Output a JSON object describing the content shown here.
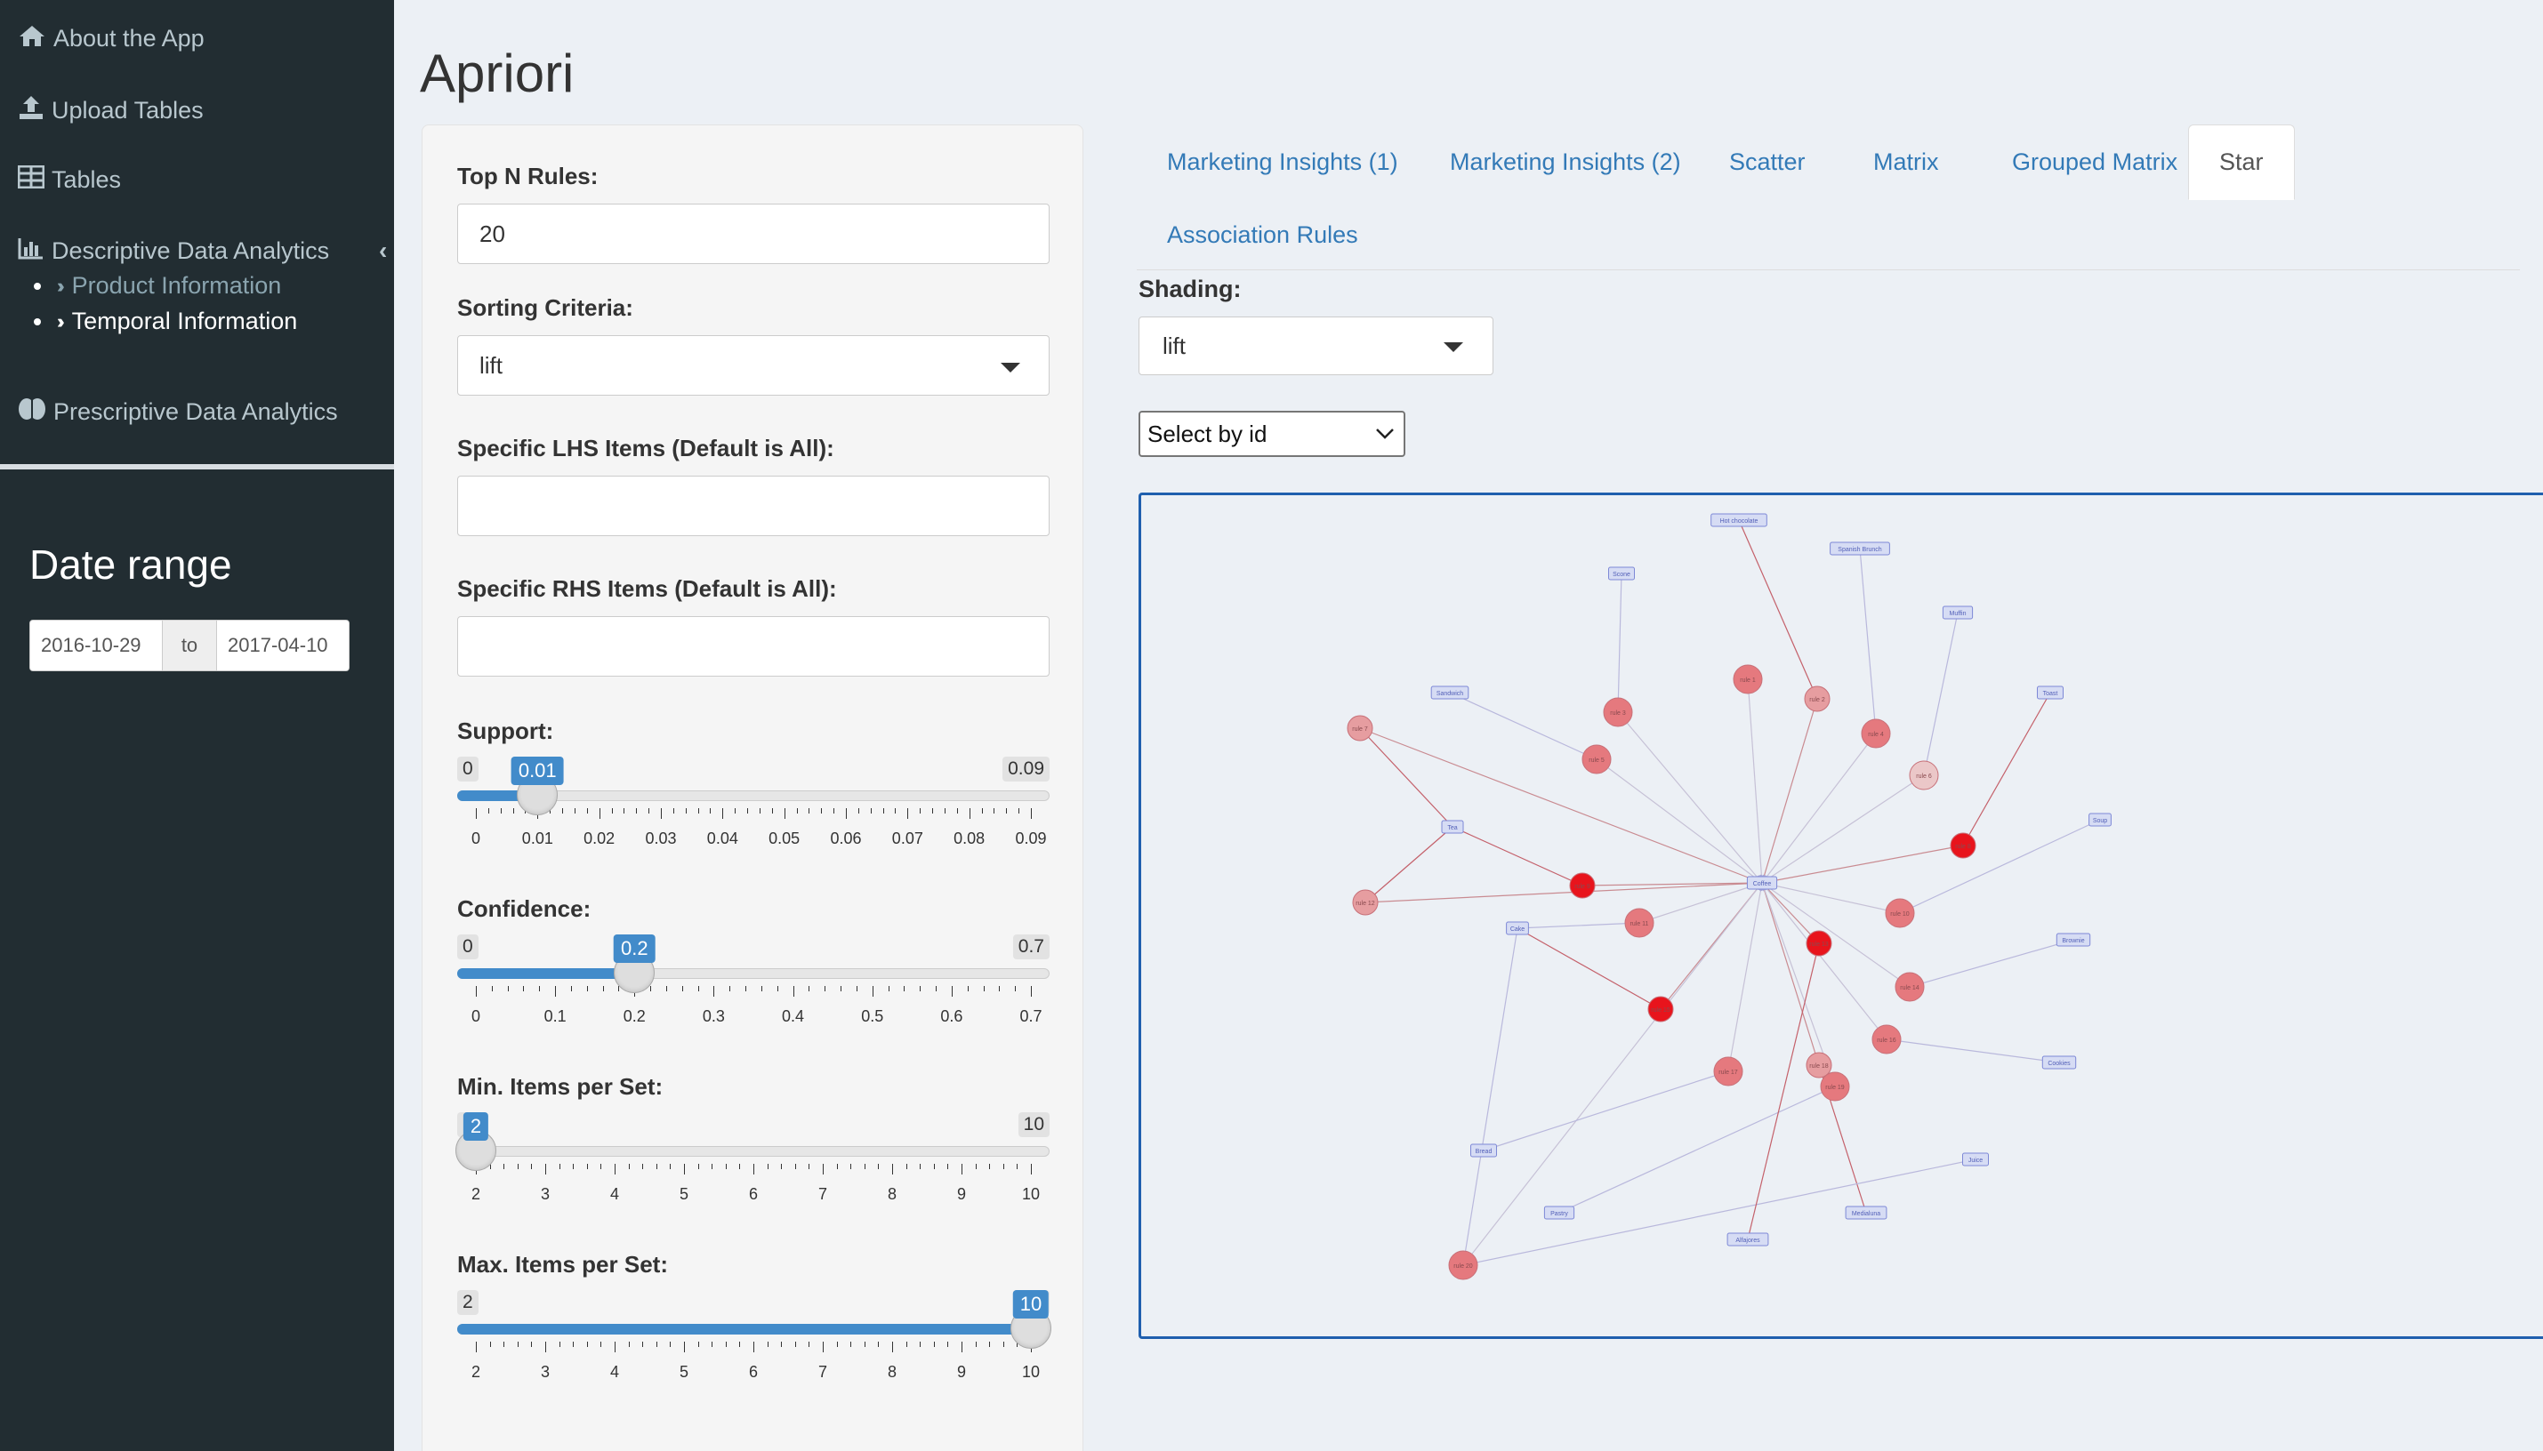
{
  "sidebar": {
    "items": [
      {
        "label": "About the App",
        "icon": "home-icon"
      },
      {
        "label": "Upload Tables",
        "icon": "upload-icon"
      },
      {
        "label": "Tables",
        "icon": "table-icon"
      },
      {
        "label": "Descriptive Data Analytics",
        "icon": "bar-chart-icon"
      },
      {
        "label": "Prescriptive Data Analytics",
        "icon": "brain-icon"
      }
    ],
    "sub_items": [
      {
        "label": "Product Information"
      },
      {
        "label": "Temporal Information"
      }
    ],
    "date_range": {
      "title": "Date range",
      "start": "2016-10-29",
      "separator": "to",
      "end": "2017-04-10"
    }
  },
  "page": {
    "title": "Apriori"
  },
  "controls": {
    "top_n": {
      "label": "Top N Rules:",
      "value": "20"
    },
    "sorting": {
      "label": "Sorting Criteria:",
      "value": "lift"
    },
    "lhs": {
      "label": "Specific LHS Items (Default is All):",
      "value": ""
    },
    "rhs": {
      "label": "Specific RHS Items (Default is All):",
      "value": ""
    },
    "support": {
      "label": "Support:",
      "min": "0",
      "max": "0.09",
      "value": "0.01",
      "fraction": 0.111,
      "ticks": [
        "0",
        "0.01",
        "0.02",
        "0.03",
        "0.04",
        "0.05",
        "0.06",
        "0.07",
        "0.08",
        "0.09"
      ]
    },
    "confidence": {
      "label": "Confidence:",
      "min": "0",
      "max": "0.7",
      "value": "0.2",
      "fraction": 0.2857,
      "ticks": [
        "0",
        "0.1",
        "0.2",
        "0.3",
        "0.4",
        "0.5",
        "0.6",
        "0.7"
      ]
    },
    "min_items": {
      "label": "Min. Items per Set:",
      "min": "2",
      "max": "10",
      "value": "2",
      "fraction": 0,
      "ticks": [
        "2",
        "3",
        "4",
        "5",
        "6",
        "7",
        "8",
        "9",
        "10"
      ]
    },
    "max_items": {
      "label": "Max. Items per Set:",
      "min": "2",
      "max": "10",
      "value": "10",
      "fraction": 1,
      "ticks": [
        "2",
        "3",
        "4",
        "5",
        "6",
        "7",
        "8",
        "9",
        "10"
      ]
    }
  },
  "tabs": [
    {
      "label": "Marketing Insights (1)",
      "active": false
    },
    {
      "label": "Marketing Insights (2)",
      "active": false
    },
    {
      "label": "Scatter",
      "active": false
    },
    {
      "label": "Matrix",
      "active": false
    },
    {
      "label": "Grouped Matrix",
      "active": false
    },
    {
      "label": "Star",
      "active": true
    },
    {
      "label": "Association Rules",
      "active": false
    }
  ],
  "shading": {
    "label": "Shading:",
    "value": "lift"
  },
  "id_select": {
    "value": "Select by id"
  },
  "graph": {
    "center": "Coffee",
    "items": [
      "Hot chocolate",
      "Spanish Brunch",
      "Scone",
      "Muffin",
      "Sandwich",
      "Toast",
      "Tea",
      "Soup",
      "Cake",
      "Brownie",
      "Bread",
      "Cookies",
      "Pastry",
      "Medialuna",
      "Juice",
      "Alfajores"
    ],
    "rules": [
      "rule 1",
      "rule 2",
      "rule 3",
      "rule 4",
      "rule 5",
      "rule 6",
      "rule 7",
      "rule 8",
      "rule 9",
      "rule 10",
      "rule 11",
      "rule 12",
      "rule 13",
      "rule 14",
      "rule 15",
      "rule 16",
      "rule 17",
      "rule 18",
      "rule 19",
      "rule 20"
    ],
    "colors": {
      "node_strong": "#e8141c",
      "node_mid": "#e5797e",
      "node_light": "#ebc7c8",
      "item_fill": "#d6dcf4",
      "item_stroke": "#7d88d6"
    }
  }
}
